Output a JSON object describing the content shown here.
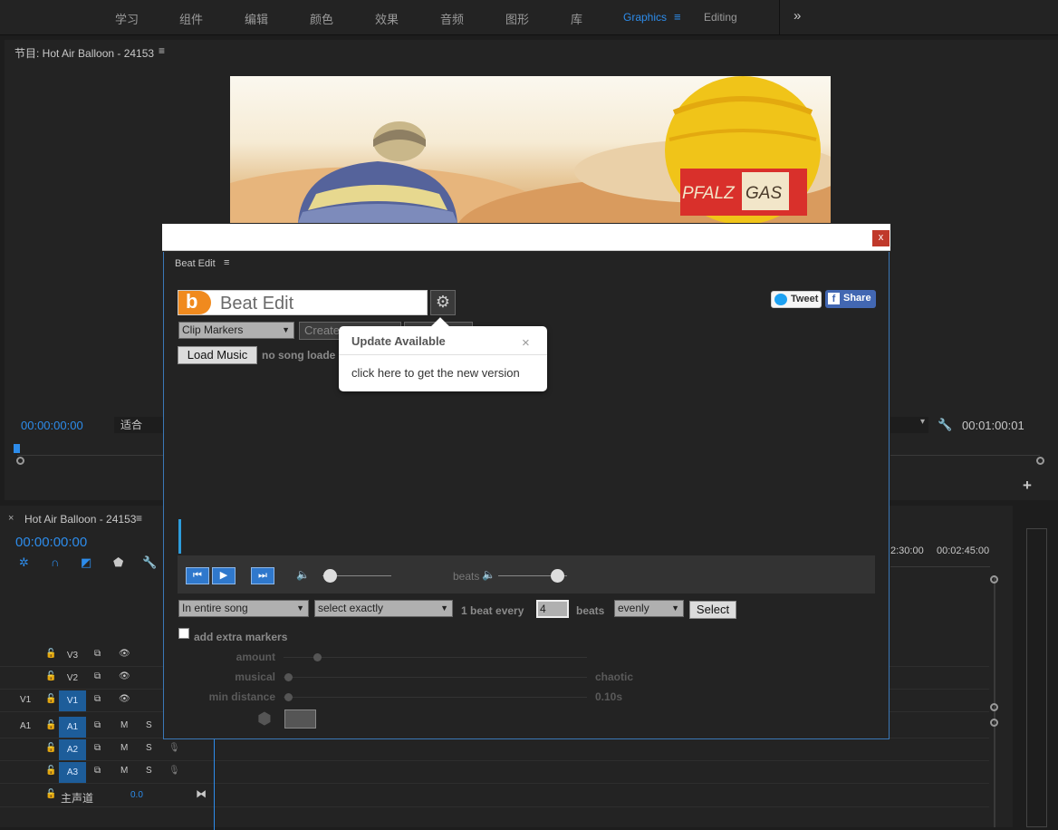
{
  "workspaces": {
    "items": [
      "学习",
      "组件",
      "编辑",
      "颜色",
      "效果",
      "音频",
      "图形",
      "库"
    ],
    "active": "Graphics",
    "editing": "Editing",
    "menu_glyph": "≡",
    "more_glyph": "»"
  },
  "monitor": {
    "title": "节目: Hot Air Balloon - 24153",
    "menu_glyph": "≡",
    "timecode_current": "00:00:00:00",
    "fit": "适合",
    "timecode_duration": "00:01:00:01",
    "add_glyph": "+"
  },
  "video": {
    "balloon_text_left": "PFALZ",
    "balloon_text_right": "GAS"
  },
  "timeline": {
    "close_glyph": "×",
    "title": "Hot Air Balloon - 24153",
    "menu_glyph": "≡",
    "timecode": "00:00:00:00",
    "ruler_labels": [
      "2:30:00",
      "00:02:45:00"
    ],
    "tracks": [
      {
        "source": "",
        "name": "V3",
        "targeted": false,
        "kind": "video"
      },
      {
        "source": "",
        "name": "V2",
        "targeted": false,
        "kind": "video"
      },
      {
        "source": "V1",
        "name": "V1",
        "targeted": true,
        "kind": "video"
      },
      {
        "source": "A1",
        "name": "A1",
        "targeted": true,
        "kind": "audio"
      },
      {
        "source": "",
        "name": "A2",
        "targeted": true,
        "kind": "audio"
      },
      {
        "source": "",
        "name": "A3",
        "targeted": true,
        "kind": "audio"
      }
    ],
    "mute_label": "M",
    "solo_label": "S",
    "master_label": "主声道",
    "master_value": "0.0"
  },
  "modal": {
    "close_label": "x"
  },
  "beat_edit": {
    "panel_title": "Beat Edit",
    "menu_glyph": "≡",
    "logo_letter": "b",
    "logo_text": "Beat Edit",
    "tweet_label": "Tweet",
    "share_label": "Share",
    "mode_select": "Clip Markers",
    "create_label": "Create",
    "load_music_label": "Load Music",
    "no_song_text": "no song loade",
    "beats_label": "beats",
    "range_select": "In entire song",
    "match_select": "select exactly",
    "beat_every_label": "1 beat every",
    "beat_count": "4",
    "beats_unit": "beats",
    "distribution_select": "evenly",
    "select_button": "Select",
    "extra_markers_label": "add extra markers",
    "amount_label": "amount",
    "musical_label": "musical",
    "chaotic_label": "chaotic",
    "min_distance_label": "min distance",
    "min_distance_value": "0.10s",
    "volume_level": 0.1,
    "beats_volume_level": 0.85
  },
  "popover": {
    "title": "Update Available",
    "close_glyph": "×",
    "body": "click here to get the new version"
  }
}
